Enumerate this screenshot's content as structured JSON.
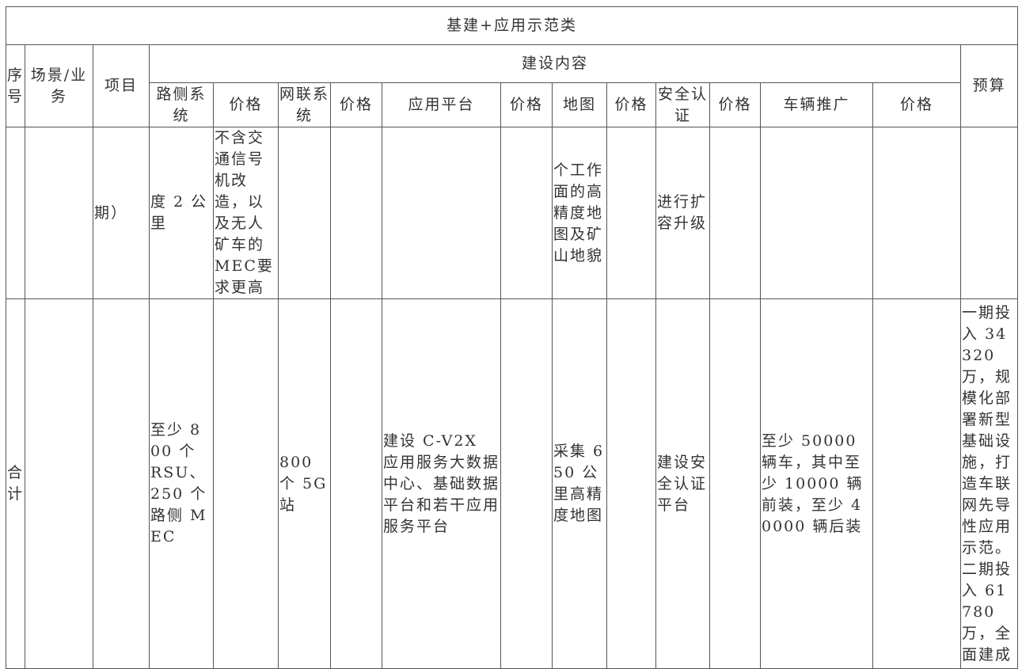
{
  "table": {
    "title": "基建+应用示范类",
    "headers": {
      "index": "序号",
      "scenario": "场景/业务",
      "project": "项目",
      "content_group": "建设内容",
      "roadside": "路侧系统",
      "price1": "价格",
      "network": "网联系统",
      "price2": "价格",
      "platform": "应用平台",
      "price3": "价格",
      "map": "地图",
      "price4": "价格",
      "security": "安全认证",
      "price5": "价格",
      "vehicle": "车辆推广",
      "price6": "价格",
      "budget": "预算"
    },
    "rows": [
      {
        "index": "",
        "scenario": "",
        "project": "期）",
        "roadside": "度 2 公里",
        "price1": "不含交通信号机改造，以及无人矿车的MEC要求更高",
        "network": "",
        "price2": "",
        "platform": "",
        "price3": "",
        "map": "个工作面的高精度地图及矿山地貌",
        "price4": "",
        "security": "进行扩容升级",
        "price5": "",
        "vehicle": "",
        "price6": "",
        "budget": ""
      },
      {
        "index": "合计",
        "scenario": "",
        "project": "",
        "roadside": "至少 800 个 RSU、250 个路侧 MEC",
        "price1": "",
        "network": "800 个 5G 站",
        "price2": "",
        "platform": "建设 C-V2X 应用服务大数据中心、基础数据平台和若干应用服务平台",
        "price3": "",
        "map": "采集 650 公里高精度地图",
        "price4": "",
        "security": "建设安全认证平台",
        "price5": "",
        "vehicle": "至少 50000 辆车，其中至少 10000 辆前装，至少 40000 辆后装",
        "price6": "",
        "budget": "一期投入 34320 万，规模化部署新型基础设施，打造车联网先导性应用示范。二期投入 61780 万，全面建成"
      }
    ]
  }
}
